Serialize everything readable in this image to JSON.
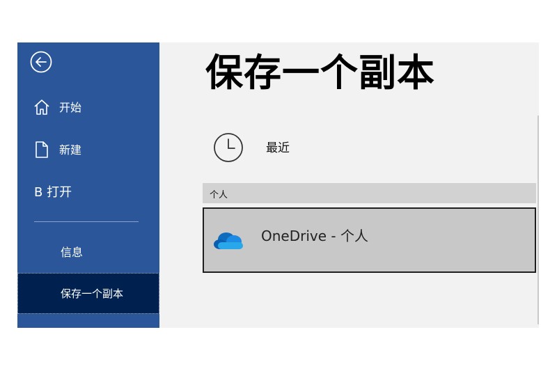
{
  "sidebar": {
    "items": [
      {
        "label": "开始",
        "icon": "home-icon"
      },
      {
        "label": "新建",
        "icon": "new-document-icon"
      },
      {
        "label": "B 打开",
        "icon": ""
      },
      {
        "label": "信息",
        "icon": ""
      },
      {
        "label": "保存一个副本",
        "icon": "",
        "selected": true
      }
    ],
    "back_icon": "back-arrow-icon"
  },
  "main": {
    "title": "保存一个副本",
    "recent": {
      "label": "最近",
      "icon": "clock-icon"
    },
    "section_header": "个人",
    "locations": [
      {
        "label": "OneDrive - 个人",
        "icon": "onedrive-cloud-icon"
      }
    ]
  },
  "colors": {
    "sidebar_bg": "#2b579a",
    "selected_bg": "#002050",
    "content_bg": "#f2f2f2",
    "location_selected_bg": "#c8c8c8",
    "onedrive_blue": "#0f6cbd"
  }
}
